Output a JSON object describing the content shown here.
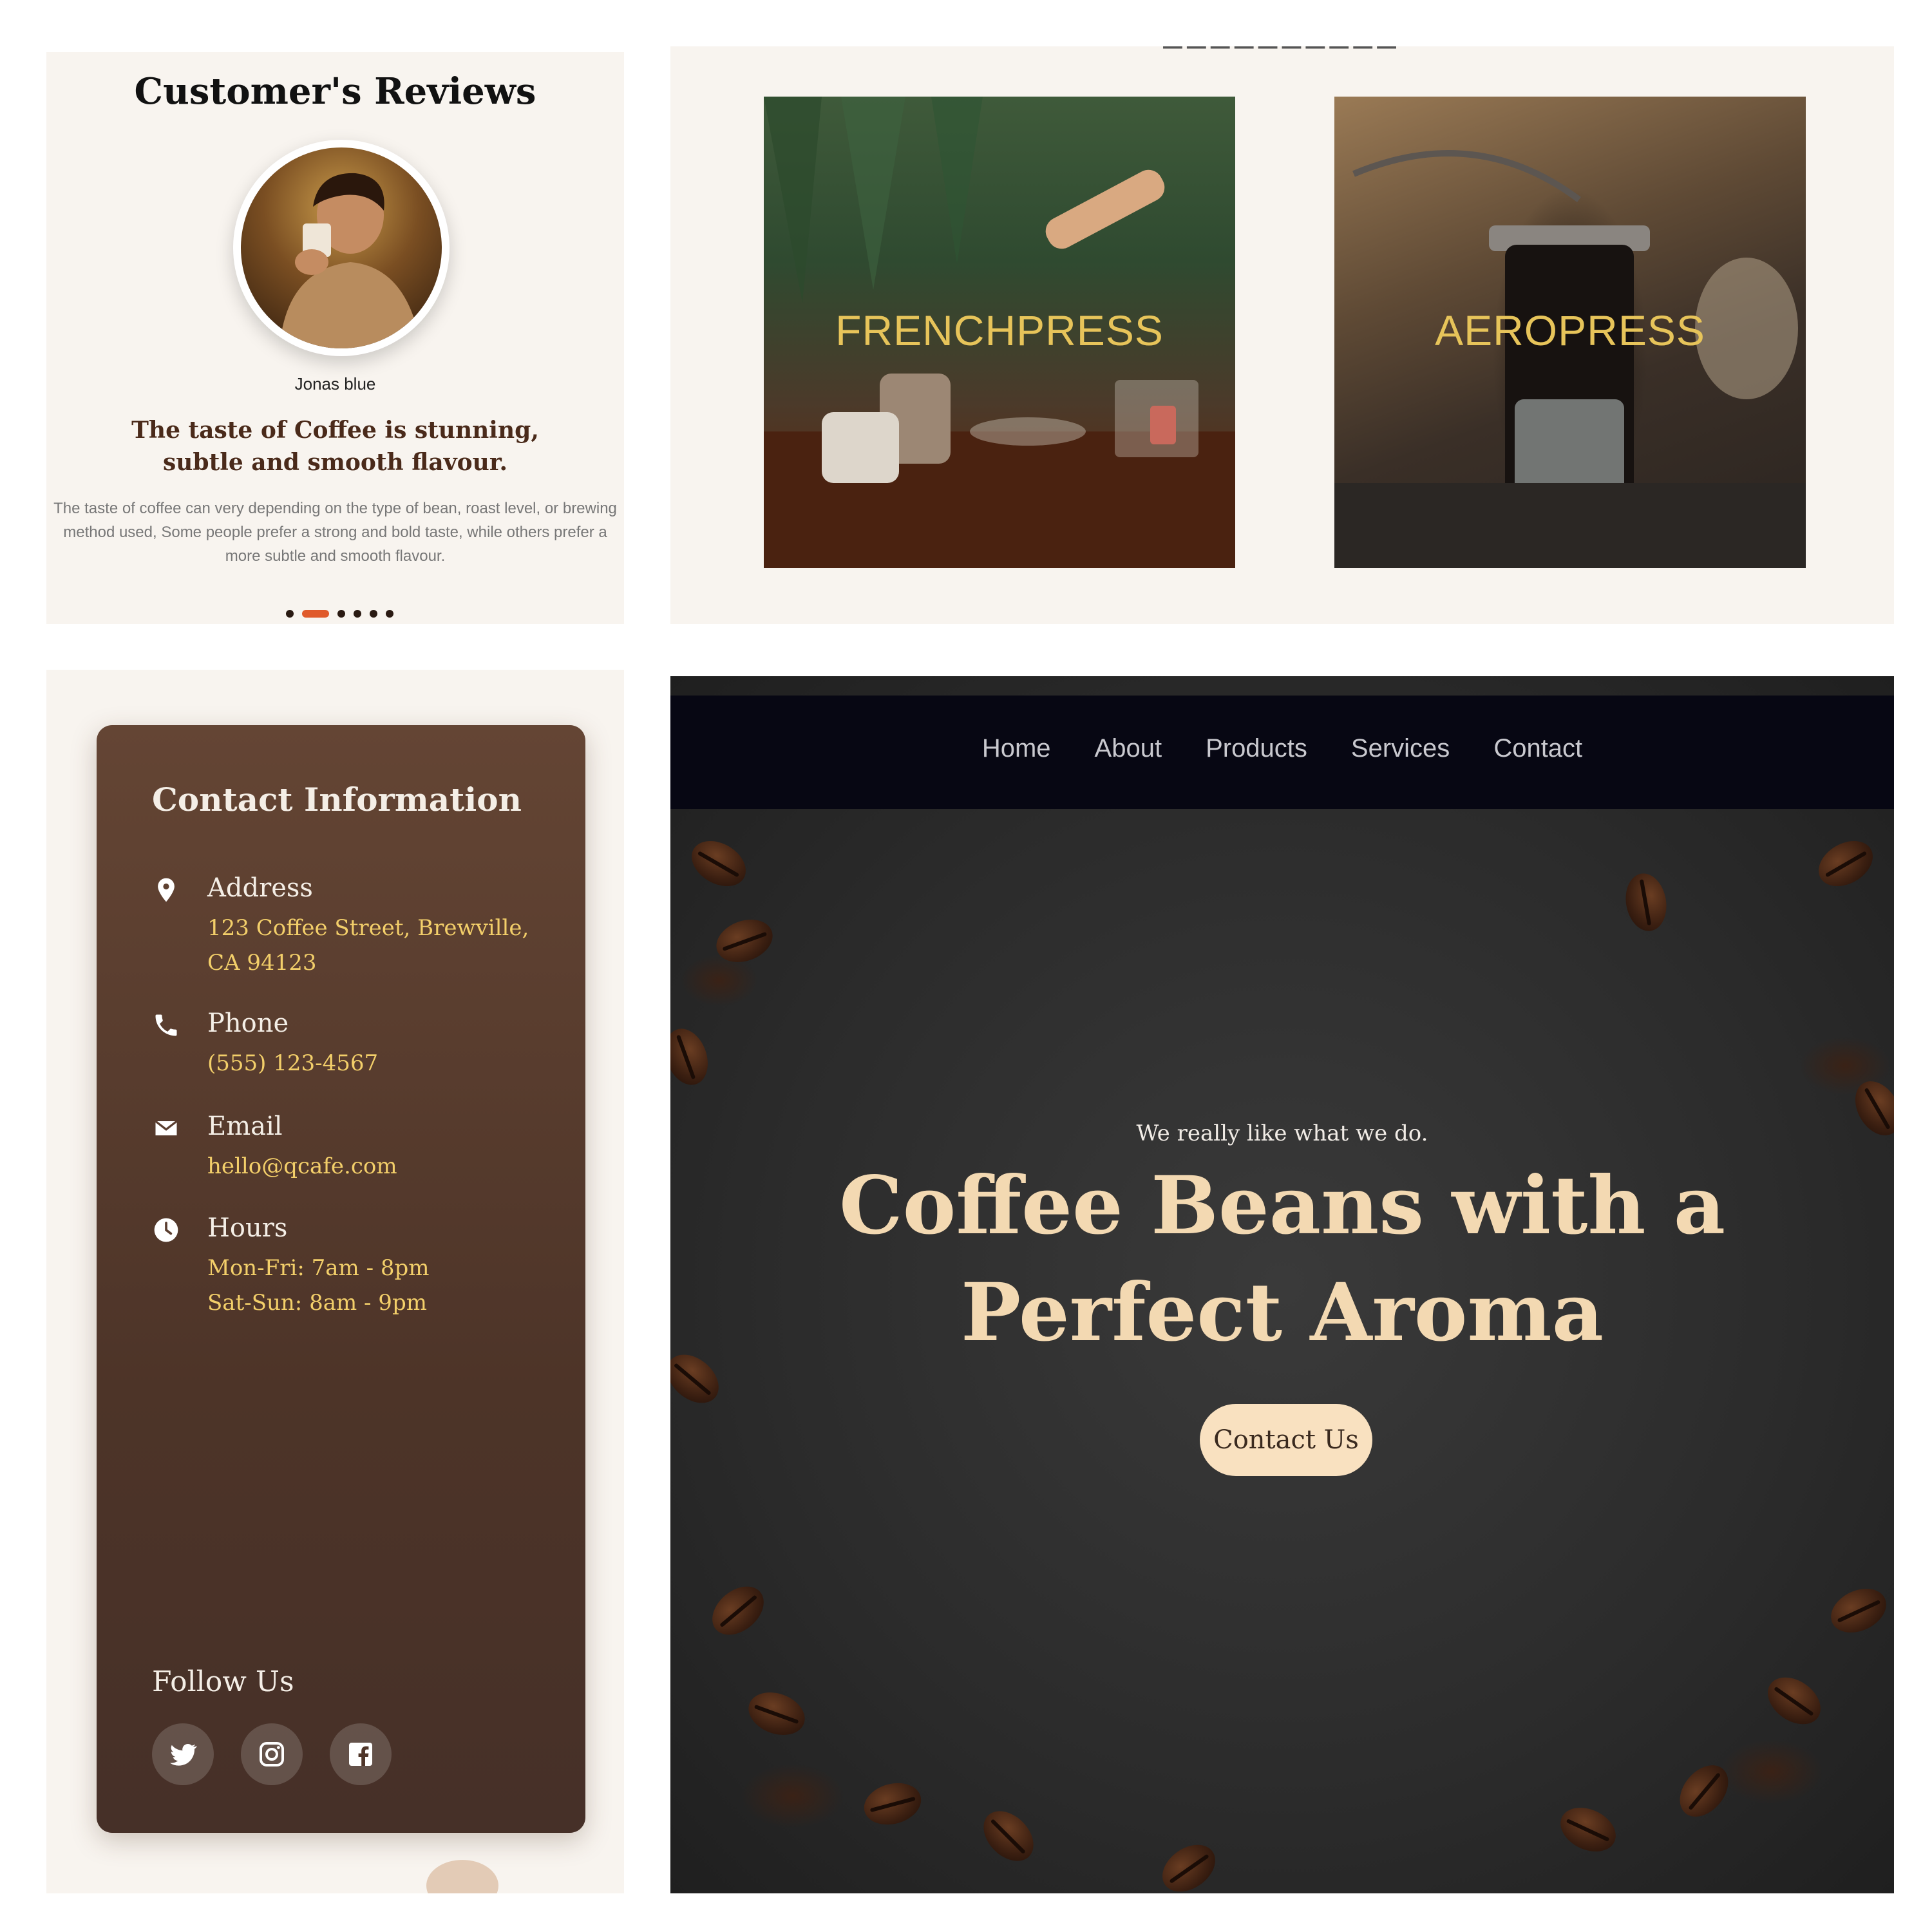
{
  "reviews": {
    "title": "Customer's Reviews",
    "reviewer_name": "Jonas blue",
    "quote": "The taste of Coffee is stunning, subtle and smooth flavour.",
    "body": "The taste of coffee can very depending on the type of bean, roast level, or brewing method used, Some people prefer a strong and bold taste, while others prefer a more subtle and smooth flavour.",
    "slider": {
      "count": 6,
      "active_index": 1,
      "accent": "#e05a2b"
    }
  },
  "brewing": {
    "cards": [
      {
        "label": "FRENCHPRESS"
      },
      {
        "label": "AEROPRESS"
      }
    ],
    "label_color": "#e7c45a"
  },
  "contact": {
    "heading": "Contact Information",
    "items": [
      {
        "icon": "location-pin-icon",
        "label": "Address",
        "lines": [
          "123 Coffee Street, Brewville,",
          "CA 94123"
        ]
      },
      {
        "icon": "phone-icon",
        "label": "Phone",
        "lines": [
          "(555) 123-4567"
        ]
      },
      {
        "icon": "envelope-icon",
        "label": "Email",
        "lines": [
          "hello@qcafe.com"
        ]
      },
      {
        "icon": "clock-icon",
        "label": "Hours",
        "lines": [
          "Mon-Fri: 7am - 8pm",
          "Sat-Sun: 8am - 9pm"
        ]
      }
    ],
    "follow_label": "Follow Us",
    "socials": [
      {
        "icon": "twitter-icon"
      },
      {
        "icon": "instagram-icon"
      },
      {
        "icon": "facebook-icon"
      }
    ],
    "value_color": "#f3cf6a"
  },
  "hero": {
    "nav": [
      "Home",
      "About",
      "Products",
      "Services",
      "Contact"
    ],
    "tagline": "We really like what we do.",
    "headline_line1": "Coffee Beans with a",
    "headline_line2": "Perfect Aroma",
    "cta_label": "Contact Us",
    "headline_color": "#f3d9b2"
  }
}
